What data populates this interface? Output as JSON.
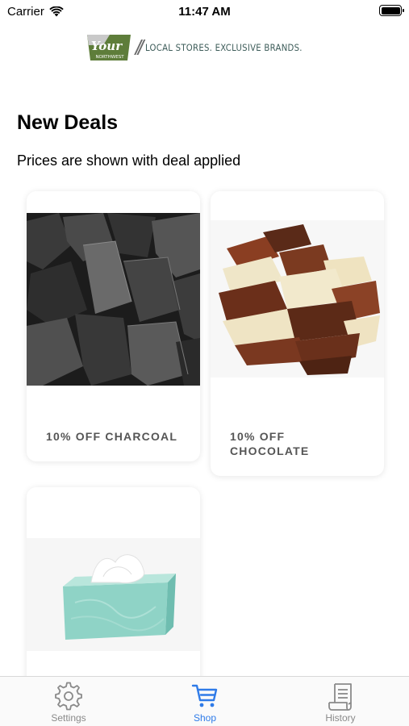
{
  "status_bar": {
    "carrier": "Carrier",
    "time": "11:47 AM"
  },
  "header": {
    "logo_text": "Your",
    "logo_subtext": "NORTHWEST",
    "tagline": "LOCAL STORES. EXCLUSIVE BRANDS."
  },
  "page": {
    "title": "New Deals",
    "subtitle": "Prices are shown with deal applied"
  },
  "deals": [
    {
      "label": "10% OFF CHARCOAL",
      "image": "charcoal-image"
    },
    {
      "label": "10% OFF CHOCOLATE",
      "image": "chocolate-image"
    },
    {
      "label": "",
      "image": "tissue-box-image"
    }
  ],
  "tabs": [
    {
      "label": "Settings",
      "icon": "gear-icon",
      "active": false
    },
    {
      "label": "Shop",
      "icon": "cart-icon",
      "active": true
    },
    {
      "label": "History",
      "icon": "receipt-icon",
      "active": false
    }
  ],
  "colors": {
    "accent": "#2f7be8",
    "tab_inactive": "#8a8a8a",
    "logo_green": "#5e7d3a",
    "tagline": "#3e5d5a"
  }
}
